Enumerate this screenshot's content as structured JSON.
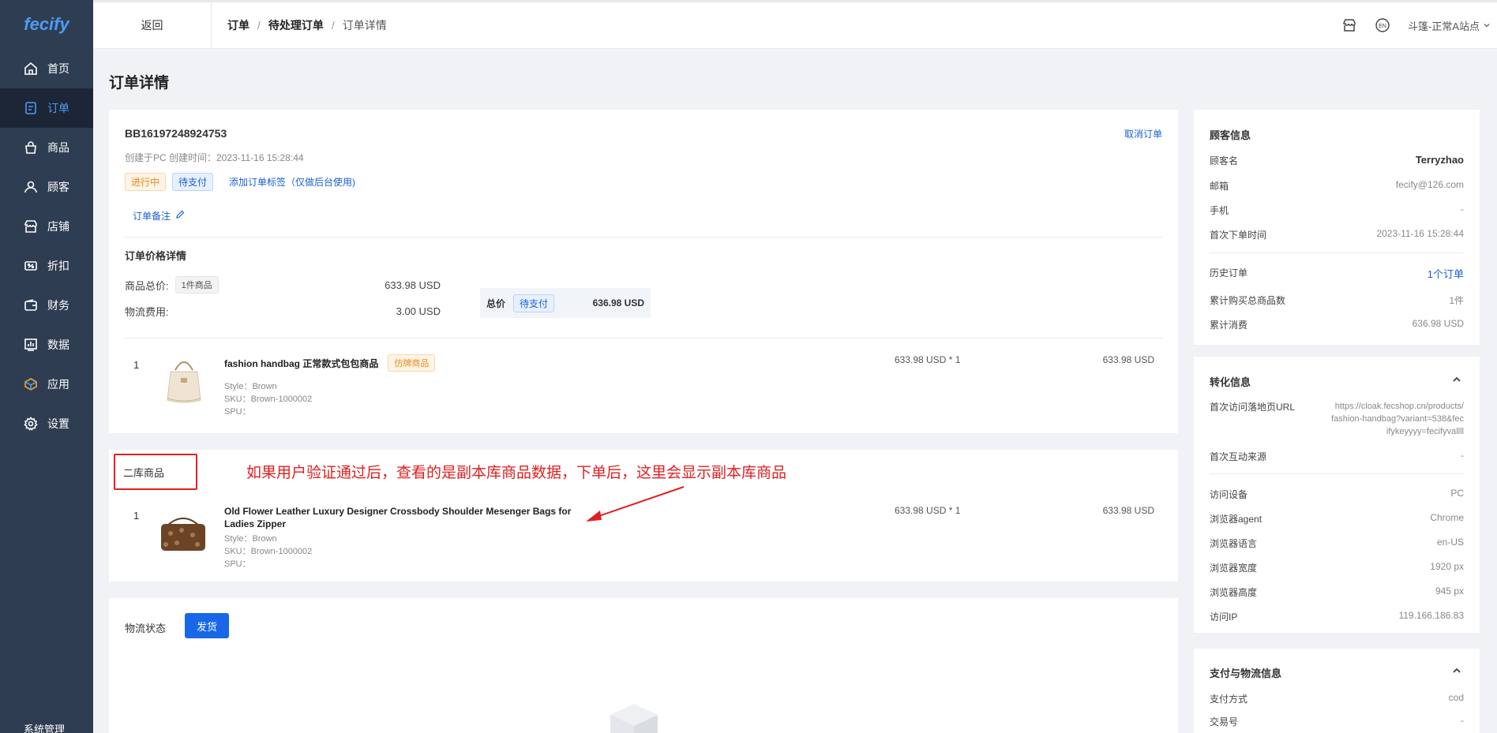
{
  "app": {
    "logo": "fecify"
  },
  "sidebar": {
    "items": [
      {
        "label": "首页",
        "icon": "home-icon"
      },
      {
        "label": "订单",
        "icon": "order-icon",
        "active": true
      },
      {
        "label": "商品",
        "icon": "bag-icon"
      },
      {
        "label": "顾客",
        "icon": "user-icon"
      },
      {
        "label": "店铺",
        "icon": "store-icon"
      },
      {
        "label": "折扣",
        "icon": "discount-icon"
      },
      {
        "label": "财务",
        "icon": "wallet-icon"
      },
      {
        "label": "数据",
        "icon": "chart-icon"
      },
      {
        "label": "应用",
        "icon": "apps-icon"
      },
      {
        "label": "设置",
        "icon": "gear-icon"
      }
    ],
    "bottom_label": "系统管理"
  },
  "topbar": {
    "back": "返回",
    "crumbs": [
      "订单",
      "待处理订单",
      "订单详情"
    ],
    "store_name": "斗篷-正常A站点"
  },
  "page": {
    "title": "订单详情"
  },
  "order": {
    "number": "BB16197248924753",
    "cancel": "取消订单",
    "created": "创建于PC 创建时间：2023-11-16 15:28:44",
    "status_tags": [
      "进行中",
      "待支付"
    ],
    "add_tag": "添加订单标签（仅做后台使用)",
    "note": "订单备注",
    "price_title": "订单价格详情",
    "goods_total_label": "商品总价:",
    "goods_count": "1件商品",
    "goods_total": "633.98 USD",
    "shipping_label": "物流费用:",
    "shipping": "3.00 USD",
    "total_label": "总价",
    "total_status": "待支付",
    "total": "636.98 USD",
    "items": [
      {
        "index": "1",
        "name": "fashion handbag 正常款式包包商品",
        "badge": "仿牌商品",
        "style": "Style：Brown",
        "sku": "SKU：Brown-1000002",
        "spu": "SPU：",
        "unit": "633.98 USD * 1",
        "subtotal": "633.98 USD"
      }
    ]
  },
  "second": {
    "title": "二库商品",
    "annotation": "如果用户验证通过后，查看的是副本库商品数据，下单后，这里会显示副本库商品",
    "items": [
      {
        "index": "1",
        "name_line1": "Old Flower Leather Luxury Designer Crossbody Shoulder Mesenger Bags for",
        "name_line2": "Ladies Zipper",
        "style": "Style：Brown",
        "sku": "SKU：Brown-1000002",
        "spu": "SPU：",
        "unit": "633.98 USD * 1",
        "subtotal": "633.98 USD"
      }
    ]
  },
  "shipping": {
    "title": "物流状态",
    "button": "发货"
  },
  "customer": {
    "title": "顾客信息",
    "rows": [
      {
        "k": "顾客名",
        "v": "Terryzhao"
      },
      {
        "k": "邮箱",
        "v": "fecify@126.com"
      },
      {
        "k": "手机",
        "v": "-"
      },
      {
        "k": "首次下单时间",
        "v": "2023-11-16 15:28:44"
      }
    ],
    "history_label": "历史订单",
    "history_value": "1个订单",
    "rows2": [
      {
        "k": "累计购买总商品数",
        "v": "1件"
      },
      {
        "k": "累计消费",
        "v": "636.98 USD"
      }
    ]
  },
  "conversion": {
    "title": "转化信息",
    "landing_label": "首次访问落地页URL",
    "landing_url": [
      "https://cloak.fecshop.cn/products/",
      "fashion-handbag?variant=538&fec",
      "ifykeyyyy=fecifyvallll"
    ],
    "source_label": "首次互动来源",
    "source_value": "-",
    "rows": [
      {
        "k": "访问设备",
        "v": "PC"
      },
      {
        "k": "浏览器agent",
        "v": "Chrome"
      },
      {
        "k": "浏览器语言",
        "v": "en-US"
      },
      {
        "k": "浏览器宽度",
        "v": "1920 px"
      },
      {
        "k": "浏览器高度",
        "v": "945 px"
      },
      {
        "k": "访问IP",
        "v": "119.166.186.83"
      }
    ]
  },
  "payment": {
    "title": "支付与物流信息",
    "rows": [
      {
        "k": "支付方式",
        "v": "cod"
      },
      {
        "k": "交易号",
        "v": "-"
      }
    ]
  },
  "colors": {
    "primary": "#1767e8",
    "sidebar": "#2f3d52",
    "annotation": "#e02020"
  }
}
